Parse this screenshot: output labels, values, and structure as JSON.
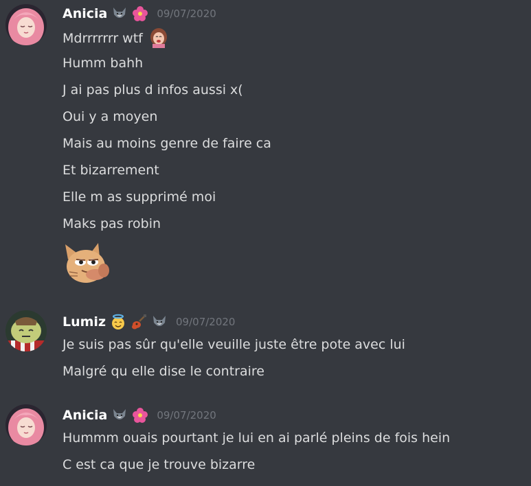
{
  "messages": [
    {
      "author": "Anicia",
      "badges": [
        "wolf-emoji",
        "hibiscus-emoji"
      ],
      "timestamp": "09/07/2020",
      "lines": [
        "Mdrrrrrrr wtf",
        "Humm bahh",
        "J ai pas plus d infos aussi x(",
        "Oui y a moyen",
        "Mais au moins genre de faire ca",
        "Et bizarrement",
        "Elle m as supprimé moi",
        "Maks pas robin"
      ],
      "inline_emoji": "laughing-girl-emoji",
      "sticker": "pepe-cat-emoji"
    },
    {
      "author": "Lumiz",
      "badges": [
        "angel-smile-emoji",
        "guitar-emoji",
        "wolf-emoji"
      ],
      "timestamp": "09/07/2020",
      "lines": [
        "Je suis pas sûr qu'elle veuille juste être pote avec lui",
        "Malgré qu elle dise le contraire"
      ]
    },
    {
      "author": "Anicia",
      "badges": [
        "wolf-emoji",
        "hibiscus-emoji"
      ],
      "timestamp": "09/07/2020",
      "lines": [
        "Hummm ouais pourtant je lui en ai parlé pleins de fois hein",
        "C est ca que je trouve bizarre"
      ]
    }
  ],
  "colors": {
    "background": "#36393f",
    "username": "#ffffff",
    "message_text": "#dcddde",
    "timestamp": "#72767d"
  }
}
